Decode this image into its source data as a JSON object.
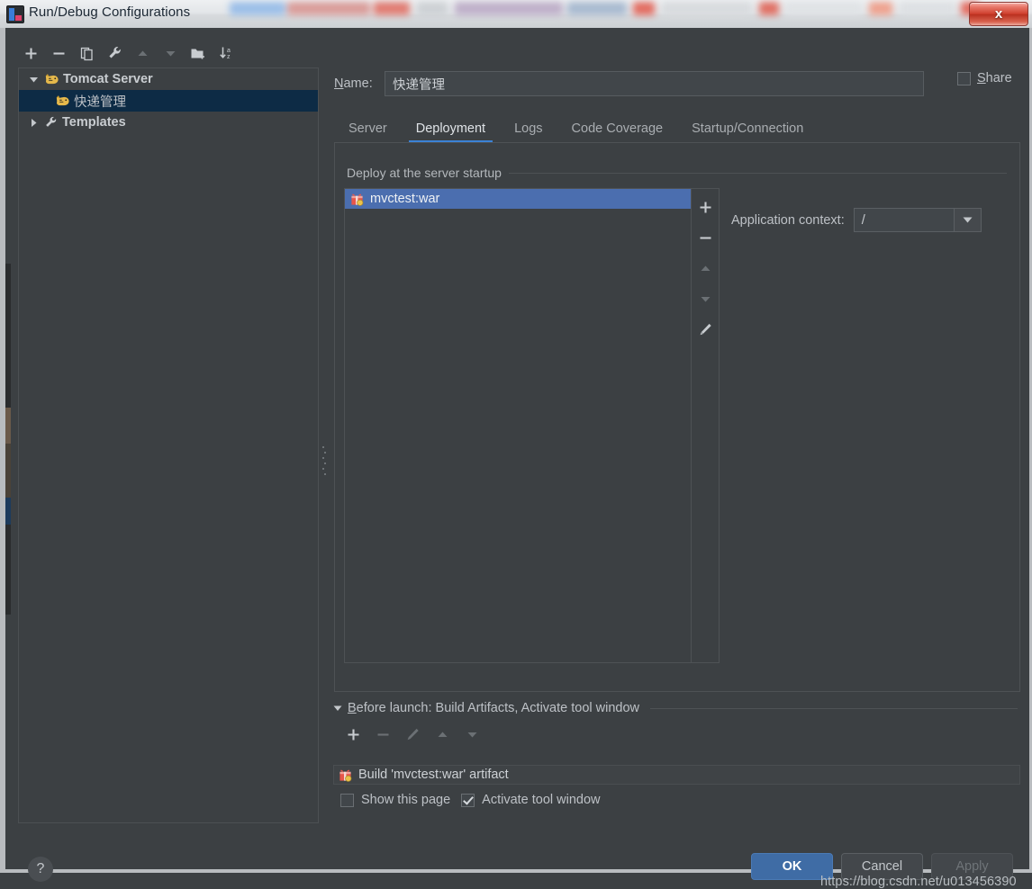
{
  "window": {
    "title": "Run/Debug Configurations",
    "app_icon": "intellij-idea-icon",
    "close_label": "x"
  },
  "left_pane": {
    "toolbar": [
      {
        "name": "add-configuration-button",
        "icon": "plus-icon",
        "enabled": true
      },
      {
        "name": "remove-configuration-button",
        "icon": "minus-icon",
        "enabled": true
      },
      {
        "name": "copy-configuration-button",
        "icon": "copy-icon",
        "enabled": true
      },
      {
        "name": "edit-defaults-button",
        "icon": "wrench-icon",
        "enabled": true
      },
      {
        "name": "move-up-button",
        "icon": "arrow-up-icon",
        "enabled": false
      },
      {
        "name": "move-down-button",
        "icon": "arrow-down-icon",
        "enabled": false
      },
      {
        "name": "create-folder-button",
        "icon": "folder-add-icon",
        "enabled": true
      },
      {
        "name": "sort-configurations-button",
        "icon": "sort-az-icon",
        "enabled": true
      }
    ],
    "tree": [
      {
        "label": "Tomcat Server",
        "icon": "tomcat-cat-icon",
        "twist": "expanded",
        "level": 0,
        "selected": false,
        "bold": true
      },
      {
        "label": "快递管理",
        "icon": "tomcat-cat-icon",
        "twist": "none",
        "level": 1,
        "selected": true,
        "bold": false
      },
      {
        "label": "Templates",
        "icon": "wrench-icon",
        "twist": "collapsed",
        "level": 0,
        "selected": false,
        "bold": true
      }
    ]
  },
  "right_pane": {
    "name_label": "Name:",
    "name_label_mnemonic": "N",
    "name_label_rest": "ame:",
    "name_value": "快递管理",
    "name_placeholder": "",
    "share": {
      "label": "Share",
      "mnemonic": "S",
      "rest": "hare",
      "checked": false
    },
    "tabs": [
      {
        "label": "Server",
        "active": false
      },
      {
        "label": "Deployment",
        "active": true
      },
      {
        "label": "Logs",
        "active": false
      },
      {
        "label": "Code Coverage",
        "active": false
      },
      {
        "label": "Startup/Connection",
        "active": false
      }
    ],
    "deployment": {
      "group_title": "Deploy at the server startup",
      "items": [
        {
          "label": "mvctest:war",
          "icon": "artifact-gift-icon",
          "selected": true
        }
      ],
      "list_toolbar": [
        {
          "name": "add-artifact-button",
          "icon": "plus-icon",
          "enabled": true
        },
        {
          "name": "remove-artifact-button",
          "icon": "minus-icon",
          "enabled": true
        },
        {
          "name": "move-artifact-up-button",
          "icon": "arrow-up-icon",
          "enabled": false
        },
        {
          "name": "move-artifact-down-button",
          "icon": "arrow-down-icon",
          "enabled": false
        },
        {
          "name": "edit-artifact-button",
          "icon": "pencil-icon",
          "enabled": true
        }
      ],
      "application_context_label": "Application context:",
      "application_context_value": "/"
    },
    "before_launch": {
      "title": "Before launch: Build Artifacts, Activate tool window",
      "mnemonic": "B",
      "title_rest": "efore launch: Build Artifacts, Activate tool window",
      "collapsed": false,
      "toolbar": [
        {
          "name": "add-task-button",
          "icon": "plus-icon",
          "enabled": true
        },
        {
          "name": "remove-task-button",
          "icon": "minus-icon",
          "enabled": false
        },
        {
          "name": "edit-task-button",
          "icon": "pencil-icon",
          "enabled": false
        },
        {
          "name": "move-task-up-button",
          "icon": "arrow-up-icon",
          "enabled": false
        },
        {
          "name": "move-task-down-button",
          "icon": "arrow-down-icon",
          "enabled": false
        }
      ],
      "tasks": [
        {
          "label": "Build 'mvctest:war' artifact",
          "icon": "artifact-gift-icon"
        }
      ],
      "show_this_page": {
        "label": "Show this page",
        "checked": false
      },
      "activate_tool_window": {
        "label": "Activate tool window",
        "checked": true
      }
    }
  },
  "footer": {
    "help_label": "?",
    "ok_label": "OK",
    "cancel_label": "Cancel",
    "apply_label": "Apply",
    "apply_enabled": false
  },
  "watermark": "https://blog.csdn.net/u013456390",
  "colors": {
    "background": "#3c4043",
    "selection_blue": "#4b6eaf",
    "tree_selection": "#0d2b45",
    "accent_tab": "#3b82d6",
    "primary_button": "#3f6ca5",
    "text": "#bdc1c6",
    "border": "#4e5255"
  }
}
